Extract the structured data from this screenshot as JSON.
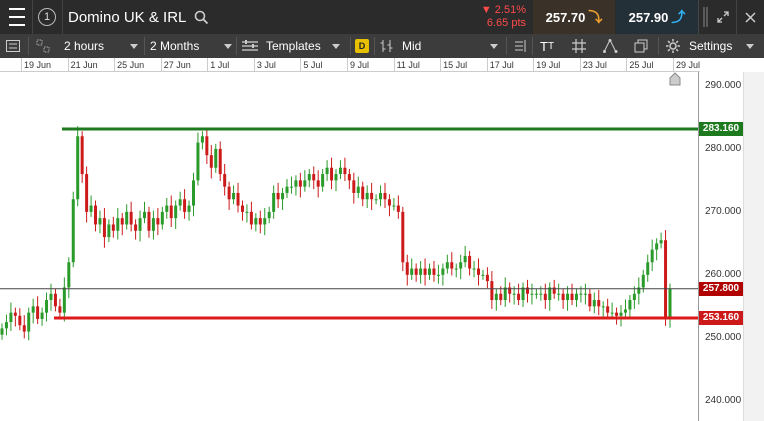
{
  "topbar": {
    "instrument_number": "1",
    "instrument_name": "Domino UK & IRL",
    "change_pct": "▼ 2.51%",
    "change_pts": "6.65 pts",
    "sell_price": "257.70",
    "buy_price": "257.90"
  },
  "toolbar": {
    "interval": "2 hours",
    "range": "2 Months",
    "templates_label": "Templates",
    "d_badge": "D",
    "price_type": "Mid",
    "tt_label": "T",
    "settings_label": "Settings"
  },
  "colors": {
    "bull": "#2a9a2a",
    "bear": "#cc1a1a",
    "resistance": "#1e7a1e",
    "support": "#dd1a1a"
  },
  "chart_data": {
    "type": "candlestick",
    "x_ticks": [
      "19 Jun",
      "21 Jun",
      "25 Jun",
      "27 Jun",
      "1 Jul",
      "3 Jul",
      "5 Jul",
      "9 Jul",
      "11 Jul",
      "15 Jul",
      "17 Jul",
      "19 Jul",
      "23 Jul",
      "25 Jul",
      "29 Jul"
    ],
    "y_ticks": [
      "290.000",
      "280.000",
      "270.000",
      "260.000",
      "250.000",
      "240.000"
    ],
    "ylim": [
      236.8,
      292.2
    ],
    "resistance_line": 283.16,
    "support_line": 253.16,
    "current_price": 257.8,
    "resistance_label": "283.160",
    "support_label": "253.160",
    "current_label": "257.800",
    "close_path": [
      251.5,
      252.5,
      254,
      253.5,
      252,
      251,
      254,
      255,
      253,
      254,
      256,
      257,
      255,
      254,
      258,
      262,
      272,
      282,
      276,
      270,
      271,
      268,
      269,
      266,
      268,
      267,
      269,
      268,
      270,
      268,
      267,
      269,
      270,
      267,
      269,
      268,
      270,
      271,
      269,
      271,
      272,
      270,
      271,
      275,
      281,
      282,
      279,
      277,
      280,
      276,
      274,
      272,
      273,
      271,
      270,
      270,
      268,
      269,
      268,
      269,
      270,
      273,
      272,
      273,
      274,
      274,
      275,
      274,
      275,
      276,
      275,
      274,
      276,
      277,
      275,
      276,
      277,
      276,
      275,
      273,
      274,
      272,
      273,
      272,
      272,
      273,
      272,
      271,
      271,
      270,
      262,
      260,
      261,
      260,
      261,
      260,
      261,
      260,
      260,
      261,
      262,
      261,
      261,
      262,
      263,
      261,
      261,
      260,
      260,
      259,
      256,
      257,
      256,
      258,
      257,
      257,
      256,
      258,
      257,
      257,
      257,
      257,
      256,
      258,
      257,
      257,
      256,
      257,
      256,
      257,
      257,
      257,
      255,
      256,
      255,
      255,
      254,
      254,
      253.5,
      254,
      254.5,
      256,
      257,
      258,
      260,
      262,
      264,
      265,
      265.5,
      253,
      257.8
    ]
  }
}
